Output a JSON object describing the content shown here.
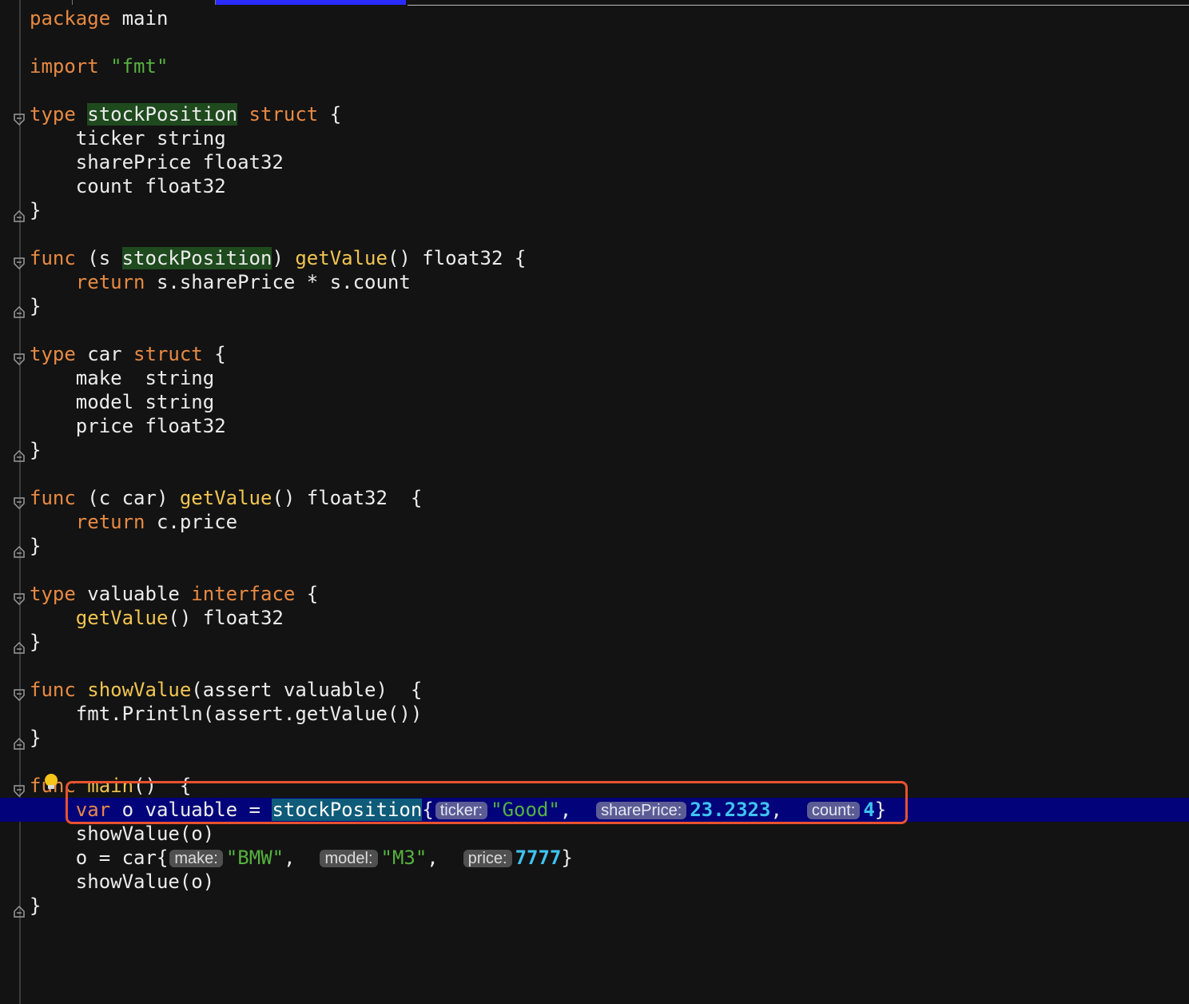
{
  "editor": {
    "language": "go",
    "lines": [
      {
        "tokens": [
          {
            "t": "package",
            "c": "kw"
          },
          {
            "t": " main"
          }
        ]
      },
      {
        "tokens": []
      },
      {
        "tokens": [
          {
            "t": "import",
            "c": "kw"
          },
          {
            "t": " "
          },
          {
            "t": "\"fmt\"",
            "c": "str"
          }
        ]
      },
      {
        "tokens": []
      },
      {
        "fold": "open",
        "tokens": [
          {
            "t": "type",
            "c": "kw"
          },
          {
            "t": " "
          },
          {
            "t": "stockPosition",
            "c": "hl-green"
          },
          {
            "t": " "
          },
          {
            "t": "struct",
            "c": "kw"
          },
          {
            "t": " {"
          }
        ]
      },
      {
        "tokens": [
          {
            "t": "    ticker string"
          }
        ]
      },
      {
        "tokens": [
          {
            "t": "    sharePrice float32"
          }
        ]
      },
      {
        "tokens": [
          {
            "t": "    count float32"
          }
        ]
      },
      {
        "fold": "close",
        "tokens": [
          {
            "t": "}"
          }
        ]
      },
      {
        "tokens": []
      },
      {
        "fold": "open",
        "tokens": [
          {
            "t": "func",
            "c": "kw"
          },
          {
            "t": " (s "
          },
          {
            "t": "stockPosition",
            "c": "hl-green"
          },
          {
            "t": ") "
          },
          {
            "t": "getValue",
            "c": "fn"
          },
          {
            "t": "() float32 {"
          }
        ]
      },
      {
        "tokens": [
          {
            "t": "    "
          },
          {
            "t": "return",
            "c": "kw"
          },
          {
            "t": " s.sharePrice * s.count"
          }
        ]
      },
      {
        "fold": "close",
        "tokens": [
          {
            "t": "}"
          }
        ]
      },
      {
        "tokens": []
      },
      {
        "fold": "open",
        "tokens": [
          {
            "t": "type",
            "c": "kw"
          },
          {
            "t": " car "
          },
          {
            "t": "struct",
            "c": "kw"
          },
          {
            "t": " {"
          }
        ]
      },
      {
        "tokens": [
          {
            "t": "    make  string"
          }
        ]
      },
      {
        "tokens": [
          {
            "t": "    model string"
          }
        ]
      },
      {
        "tokens": [
          {
            "t": "    price float32"
          }
        ]
      },
      {
        "fold": "close",
        "tokens": [
          {
            "t": "}"
          }
        ]
      },
      {
        "tokens": []
      },
      {
        "fold": "open",
        "tokens": [
          {
            "t": "func",
            "c": "kw"
          },
          {
            "t": " (c car) "
          },
          {
            "t": "getValue",
            "c": "fn"
          },
          {
            "t": "() float32  {"
          }
        ]
      },
      {
        "tokens": [
          {
            "t": "    "
          },
          {
            "t": "return",
            "c": "kw"
          },
          {
            "t": " c.price"
          }
        ]
      },
      {
        "fold": "close",
        "tokens": [
          {
            "t": "}"
          }
        ]
      },
      {
        "tokens": []
      },
      {
        "fold": "open",
        "tokens": [
          {
            "t": "type",
            "c": "kw"
          },
          {
            "t": " valuable "
          },
          {
            "t": "interface",
            "c": "kw"
          },
          {
            "t": " {"
          }
        ]
      },
      {
        "tokens": [
          {
            "t": "    "
          },
          {
            "t": "getValue",
            "c": "fn"
          },
          {
            "t": "() float32"
          }
        ]
      },
      {
        "fold": "close",
        "tokens": [
          {
            "t": "}"
          }
        ]
      },
      {
        "tokens": []
      },
      {
        "fold": "open",
        "tokens": [
          {
            "t": "func",
            "c": "kw"
          },
          {
            "t": " "
          },
          {
            "t": "showValue",
            "c": "fn"
          },
          {
            "t": "(assert valuable)  {"
          }
        ]
      },
      {
        "tokens": [
          {
            "t": "    fmt.Println(assert.getValue())"
          }
        ]
      },
      {
        "fold": "close",
        "tokens": [
          {
            "t": "}"
          }
        ]
      },
      {
        "tokens": []
      },
      {
        "fold": "open",
        "tokens": [
          {
            "t": "func",
            "c": "kw"
          },
          {
            "t": " "
          },
          {
            "t": "main",
            "c": "fn"
          },
          {
            "t": "()  {"
          }
        ]
      },
      {
        "current": true,
        "tokens": [
          {
            "t": "    "
          },
          {
            "t": "var",
            "c": "kw"
          },
          {
            "t": " o valuable = "
          },
          {
            "t": "stockPosition",
            "c": "hl-teal"
          },
          {
            "t": "{"
          },
          {
            "hint": "ticker:"
          },
          {
            "t": "\"Good\"",
            "c": "str"
          },
          {
            "t": ",  "
          },
          {
            "hint": "sharePrice:"
          },
          {
            "t": "23.2323",
            "c": "num"
          },
          {
            "t": ",  "
          },
          {
            "hint": "count:"
          },
          {
            "t": "4",
            "c": "num"
          },
          {
            "t": "}"
          }
        ]
      },
      {
        "tokens": [
          {
            "t": "    showValue(o)"
          }
        ]
      },
      {
        "tokens": [
          {
            "t": "    o = car{"
          },
          {
            "hint": "make:"
          },
          {
            "t": "\"BMW\"",
            "c": "str"
          },
          {
            "t": ",  "
          },
          {
            "hint": "model:"
          },
          {
            "t": "\"M3\"",
            "c": "str"
          },
          {
            "t": ",  "
          },
          {
            "hint": "price:"
          },
          {
            "t": "7777",
            "c": "num"
          },
          {
            "t": "}"
          }
        ]
      },
      {
        "tokens": [
          {
            "t": "    showValue(o)"
          }
        ]
      },
      {
        "fold": "close",
        "tokens": [
          {
            "t": "}"
          }
        ]
      }
    ]
  },
  "icons": {
    "fold_open": "fold-open-icon",
    "fold_close": "fold-close-icon",
    "intention": "lightbulb-icon"
  },
  "colors": {
    "background": "#131313",
    "keyword": "#e88a43",
    "string": "#56b23f",
    "function": "#f1c550",
    "number": "#3fc3f0",
    "current_line": "#02027a",
    "focus_border": "#e8522e",
    "lightbulb": "#f5c518"
  }
}
